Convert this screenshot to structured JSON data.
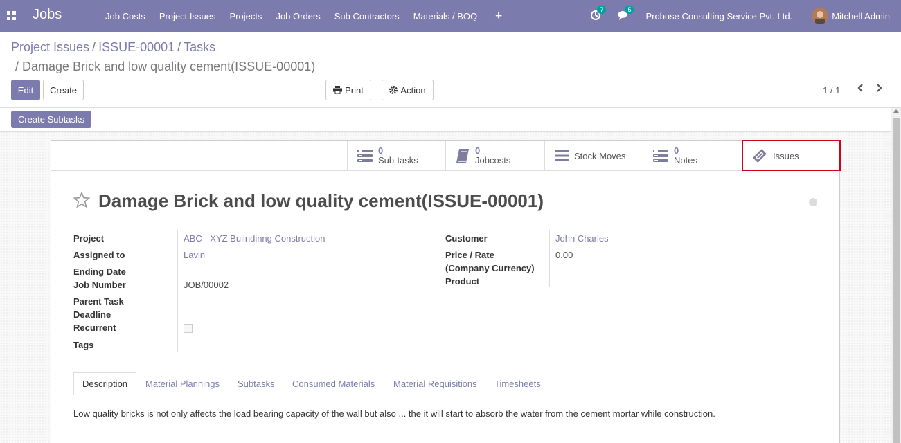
{
  "navbar": {
    "app_name": "Jobs",
    "menu": [
      "Job Costs",
      "Project Issues",
      "Projects",
      "Job Orders",
      "Sub Contractors",
      "Materials / BOQ"
    ],
    "plus": "+",
    "activity_count": "7",
    "messages_count": "5",
    "company": "Probuse Consulting Service Pvt. Ltd.",
    "user": "Mitchell Admin"
  },
  "breadcrumb": {
    "items": [
      "Project Issues",
      "ISSUE-00001",
      "Tasks"
    ],
    "sep": "/",
    "current": "Damage Brick and low quality cement(ISSUE-00001)"
  },
  "buttons": {
    "edit": "Edit",
    "create": "Create",
    "print": "Print",
    "action": "Action",
    "create_subtasks": "Create Subtasks"
  },
  "pager": {
    "value": "1 / 1"
  },
  "smart_buttons": {
    "subtasks": {
      "value": "0",
      "label": "Sub-tasks"
    },
    "jobcosts": {
      "value": "0",
      "label": "Jobcosts"
    },
    "stock_moves": {
      "label": "Stock Moves"
    },
    "notes": {
      "value": "0",
      "label": "Notes"
    },
    "issues": {
      "label": "Issues"
    }
  },
  "record": {
    "title": "Damage Brick and low quality cement(ISSUE-00001)",
    "left_fields": {
      "project_label": "Project",
      "project_value": "ABC - XYZ Builndinng Construction",
      "assigned_label": "Assigned to",
      "assigned_value": "Lavin",
      "ending_label": "Ending Date",
      "job_number_label": "Job Number",
      "job_number_value": "JOB/00002",
      "parent_label": "Parent Task",
      "deadline_label": "Deadline",
      "recurrent_label": "Recurrent",
      "tags_label": "Tags"
    },
    "right_fields": {
      "customer_label": "Customer",
      "customer_value": "John Charles",
      "price_label_1": "Price / Rate",
      "price_label_2": "(Company Currency)",
      "price_value": "0.00",
      "product_label": "Product"
    }
  },
  "tabs": [
    "Description",
    "Material Plannings",
    "Subtasks",
    "Consumed Materials",
    "Material Requisitions",
    "Timesheets"
  ],
  "description": "Low quality bricks is not only affects the load bearing capacity of the wall but also ... the it will start to absorb the water from the cement mortar while construction.",
  "colors": {
    "brand": "#7c7bad",
    "highlight": "#d0021b",
    "badge": "#00a09d"
  }
}
